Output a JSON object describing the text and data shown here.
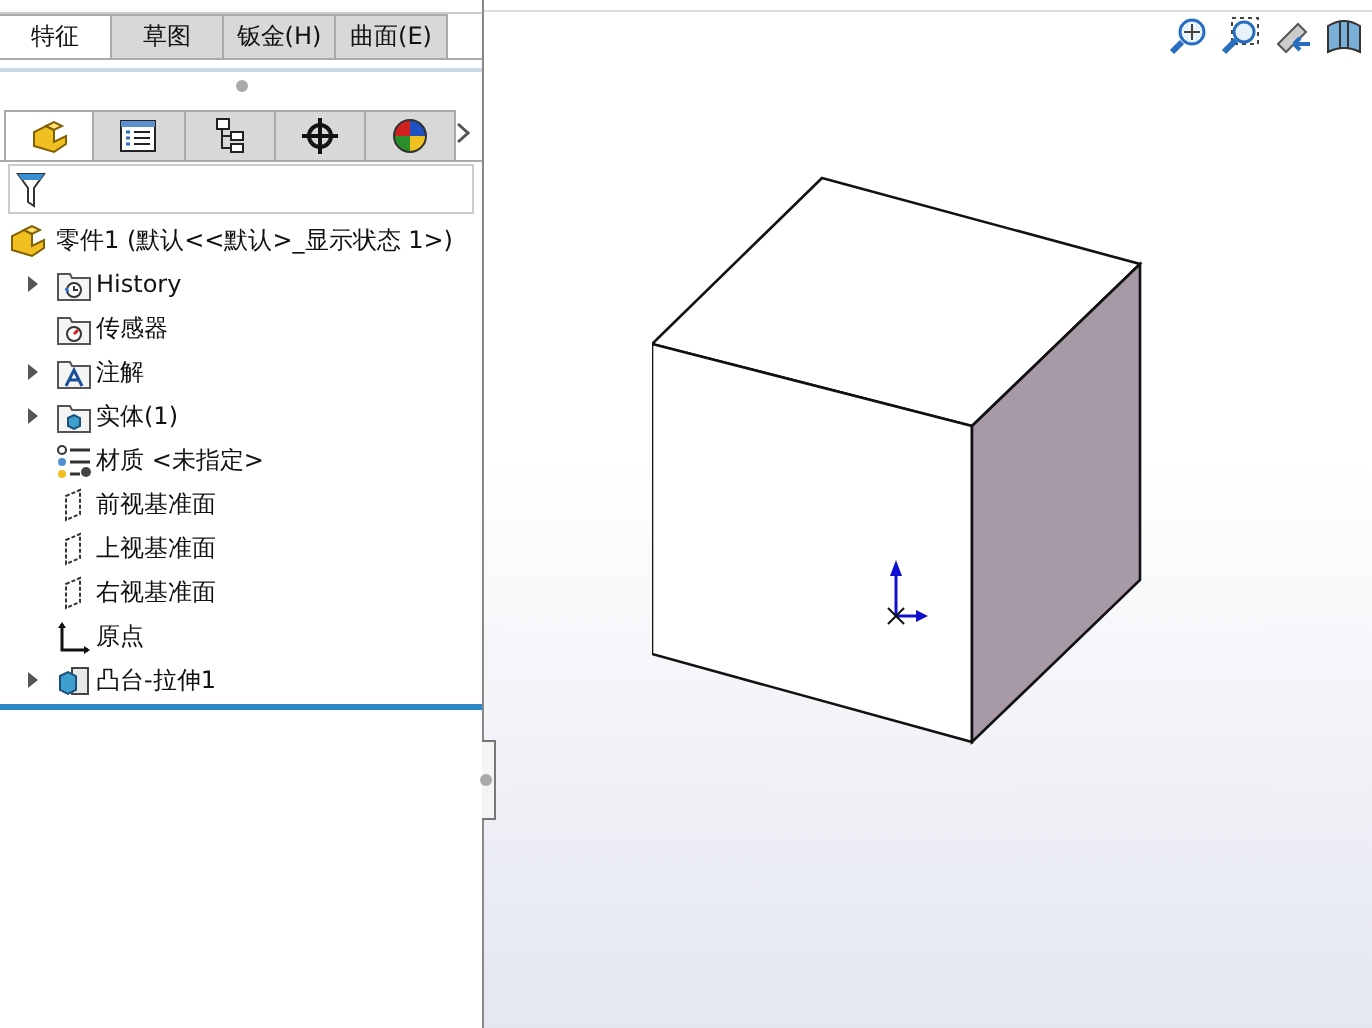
{
  "tabs": [
    {
      "label": "特征",
      "selected": true
    },
    {
      "label": "草图",
      "selected": false
    },
    {
      "label": "钣金(H)",
      "selected": false
    },
    {
      "label": "曲面(E)",
      "selected": false
    }
  ],
  "panel_tabs": [
    {
      "kind": "feature",
      "selected": true
    },
    {
      "kind": "property",
      "selected": false
    },
    {
      "kind": "config",
      "selected": false
    },
    {
      "kind": "dim",
      "selected": false
    },
    {
      "kind": "display",
      "selected": false
    }
  ],
  "tree": {
    "label": "零件1 (默认<<默认>_显示状态 1>)",
    "children": [
      {
        "kind": "history",
        "label": "History",
        "collapsed": true
      },
      {
        "kind": "sensor",
        "label": "传感器",
        "collapsed": false
      },
      {
        "kind": "annotation",
        "label": "注解",
        "collapsed": true
      },
      {
        "kind": "solid",
        "label": "实体(1)",
        "collapsed": true
      },
      {
        "kind": "material",
        "label": "材质 <未指定>",
        "collapsed": false
      },
      {
        "kind": "plane",
        "label": "前视基准面",
        "collapsed": false
      },
      {
        "kind": "plane",
        "label": "上视基准面",
        "collapsed": false
      },
      {
        "kind": "plane",
        "label": "右视基准面",
        "collapsed": false
      },
      {
        "kind": "origin",
        "label": "原点",
        "collapsed": false
      },
      {
        "kind": "extrude",
        "label": "凸台-拉伸1",
        "collapsed": true
      }
    ]
  }
}
